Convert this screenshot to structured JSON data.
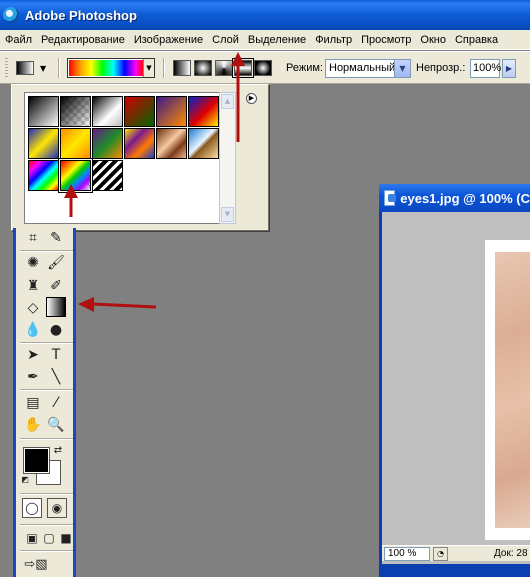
{
  "window": {
    "title": "Adobe Photoshop"
  },
  "menu": [
    "Файл",
    "Редактирование",
    "Изображение",
    "Слой",
    "Выделение",
    "Фильтр",
    "Просмотр",
    "Окно",
    "Справка"
  ],
  "options": {
    "mode_label": "Режим:",
    "mode_value": "Нормальный",
    "opacity_label": "Непрозр.:",
    "opacity_value": "100%",
    "gradient_types": [
      "linear-gradient-icon",
      "radial-gradient-icon",
      "angle-gradient-icon",
      "reflected-gradient-icon",
      "diamond-gradient-icon"
    ],
    "selected_gradient_type": "reflected-gradient-icon"
  },
  "gradient_presets": [
    "black-white",
    "transparent-checker",
    "black-white-fade",
    "red-green",
    "violet-orange",
    "blue-red-yellow",
    "blue-yellow-blue",
    "orange-yellow-orange",
    "violet-green-orange",
    "yellow-violet-orange-blue",
    "copper",
    "chrome",
    "spectrum",
    "transparent-rainbow",
    "transparent-stripes"
  ],
  "selected_preset": "transparent-rainbow",
  "toolbox": {
    "selected_tool": "gradient-tool"
  },
  "document": {
    "title": "eyes1.jpg @ 100% (C",
    "zoom": "100 %",
    "info": "Док: 28"
  },
  "colors": {
    "xp_blue": "#0a4fc4",
    "face": "#ece9d8",
    "annotation_red": "#b01010"
  }
}
